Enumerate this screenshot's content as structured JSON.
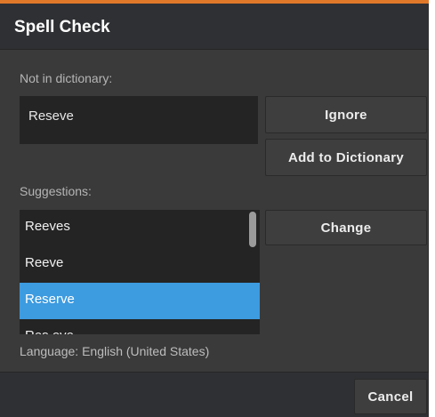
{
  "dialog": {
    "title": "Spell Check",
    "accent_color": "#e0782a"
  },
  "not_in_dictionary": {
    "label": "Not in dictionary:",
    "word": "Reseve"
  },
  "buttons": {
    "ignore": "Ignore",
    "add_to_dictionary": "Add to Dictionary",
    "change": "Change",
    "cancel": "Cancel"
  },
  "suggestions": {
    "label": "Suggestions:",
    "items": [
      "Reeves",
      "Reeve",
      "Reserve",
      "Res eve"
    ],
    "selected_index": 2
  },
  "language": "Language: English (United States)"
}
